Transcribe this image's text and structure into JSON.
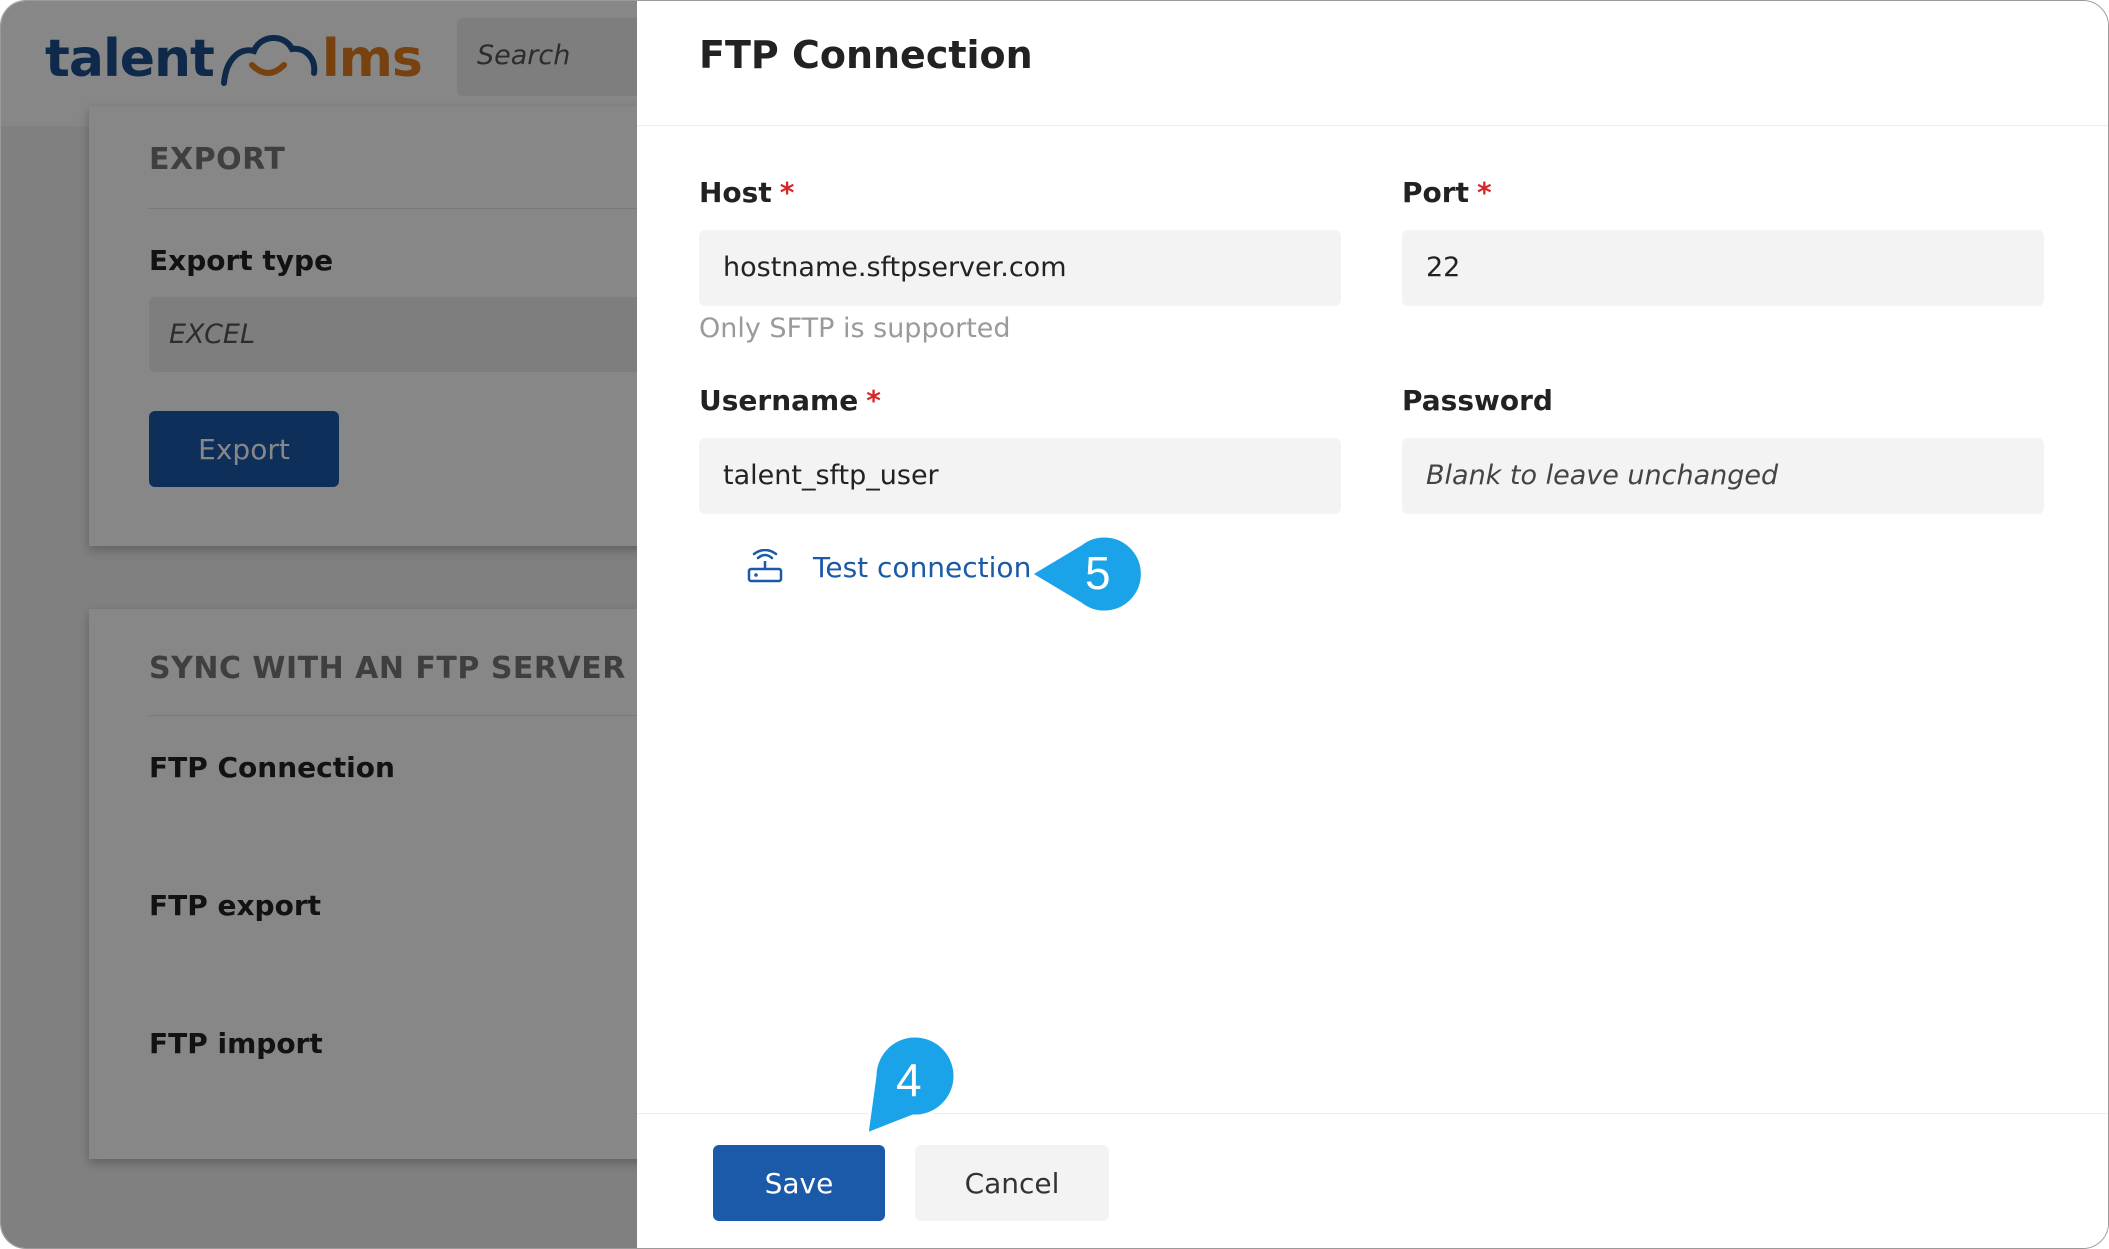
{
  "app": {
    "logo": {
      "part1": "talent",
      "part2": "lms"
    },
    "search_placeholder": "Search"
  },
  "background": {
    "export_card": {
      "heading": "EXPORT",
      "export_type_label": "Export type",
      "export_type_value": "EXCEL",
      "export_button": "Export"
    },
    "ftp_card": {
      "heading": "SYNC WITH AN FTP SERVER",
      "items": [
        "FTP Connection",
        "FTP export",
        "FTP import"
      ]
    }
  },
  "drawer": {
    "title": "FTP Connection",
    "host": {
      "label": "Host",
      "required": "*",
      "value": "hostname.sftpserver.com",
      "hint": "Only SFTP is supported"
    },
    "port": {
      "label": "Port",
      "required": "*",
      "value": "22"
    },
    "username": {
      "label": "Username",
      "required": "*",
      "value": "talent_sftp_user"
    },
    "password": {
      "label": "Password",
      "placeholder": "Blank to leave unchanged"
    },
    "test_connection": {
      "label": "Test connection",
      "icon": "router-icon"
    },
    "save_button": "Save",
    "cancel_button": "Cancel"
  },
  "callouts": {
    "test_step": "5",
    "save_step": "4",
    "color": "#1aa3e8"
  },
  "colors": {
    "primary": "#1a5aa8",
    "required": "#d9262a",
    "logo_blue": "#1b4f8a",
    "logo_orange": "#e07b1f"
  }
}
